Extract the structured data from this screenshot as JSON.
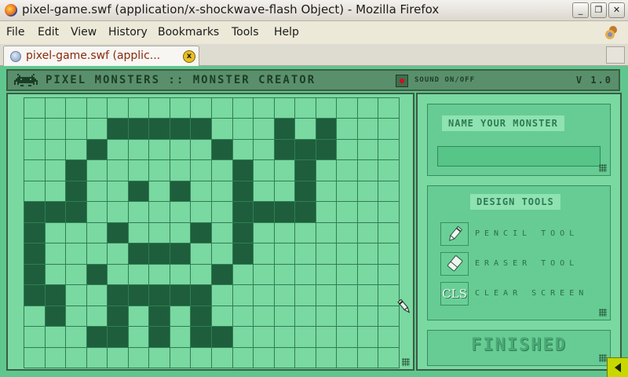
{
  "window": {
    "title": "pixel-game.swf (application/x-shockwave-flash Object) - Mozilla Firefox",
    "buttons": {
      "minimize": "_",
      "maximize": "❐",
      "close": "✕"
    }
  },
  "menu": [
    "File",
    "Edit",
    "View",
    "History",
    "Bookmarks",
    "Tools",
    "Help"
  ],
  "menu_underline": [
    "F",
    "E",
    "V",
    "s",
    "B",
    "T",
    "H"
  ],
  "tab": {
    "title": "pixel-game.swf (applic...",
    "close": "x"
  },
  "game": {
    "title": "PIXEL MONSTERS :: MONSTER CREATOR",
    "sound_label": "SOUND ON/OFF",
    "sound_on": true,
    "version": "V 1.0",
    "name_label": "NAME YOUR MONSTER",
    "name_value": "",
    "tools_label": "DESIGN TOOLS",
    "tools": [
      {
        "id": "pencil",
        "label": "PENCIL TOOL"
      },
      {
        "id": "eraser",
        "label": "ERASER TOOL"
      },
      {
        "id": "clear",
        "label": "CLEAR SCREEN",
        "button_text": "CLS"
      }
    ],
    "finished_label": "FINISHED",
    "grid": {
      "cols": 18,
      "rows": 13,
      "filled": [
        [
          4,
          1
        ],
        [
          5,
          1
        ],
        [
          6,
          1
        ],
        [
          7,
          1
        ],
        [
          8,
          1
        ],
        [
          12,
          1
        ],
        [
          14,
          1
        ],
        [
          3,
          2
        ],
        [
          9,
          2
        ],
        [
          12,
          2
        ],
        [
          13,
          2
        ],
        [
          14,
          2
        ],
        [
          2,
          3
        ],
        [
          10,
          3
        ],
        [
          13,
          3
        ],
        [
          2,
          4
        ],
        [
          5,
          4
        ],
        [
          7,
          4
        ],
        [
          10,
          4
        ],
        [
          13,
          4
        ],
        [
          0,
          5
        ],
        [
          1,
          5
        ],
        [
          2,
          5
        ],
        [
          10,
          5
        ],
        [
          11,
          5
        ],
        [
          12,
          5
        ],
        [
          13,
          5
        ],
        [
          0,
          6
        ],
        [
          4,
          6
        ],
        [
          8,
          6
        ],
        [
          10,
          6
        ],
        [
          0,
          7
        ],
        [
          5,
          7
        ],
        [
          6,
          7
        ],
        [
          7,
          7
        ],
        [
          10,
          7
        ],
        [
          0,
          8
        ],
        [
          3,
          8
        ],
        [
          9,
          8
        ],
        [
          0,
          9
        ],
        [
          1,
          9
        ],
        [
          4,
          9
        ],
        [
          5,
          9
        ],
        [
          6,
          9
        ],
        [
          7,
          9
        ],
        [
          8,
          9
        ],
        [
          1,
          10
        ],
        [
          4,
          10
        ],
        [
          6,
          10
        ],
        [
          8,
          10
        ],
        [
          3,
          11
        ],
        [
          4,
          11
        ],
        [
          6,
          11
        ],
        [
          8,
          11
        ],
        [
          9,
          11
        ]
      ]
    }
  }
}
